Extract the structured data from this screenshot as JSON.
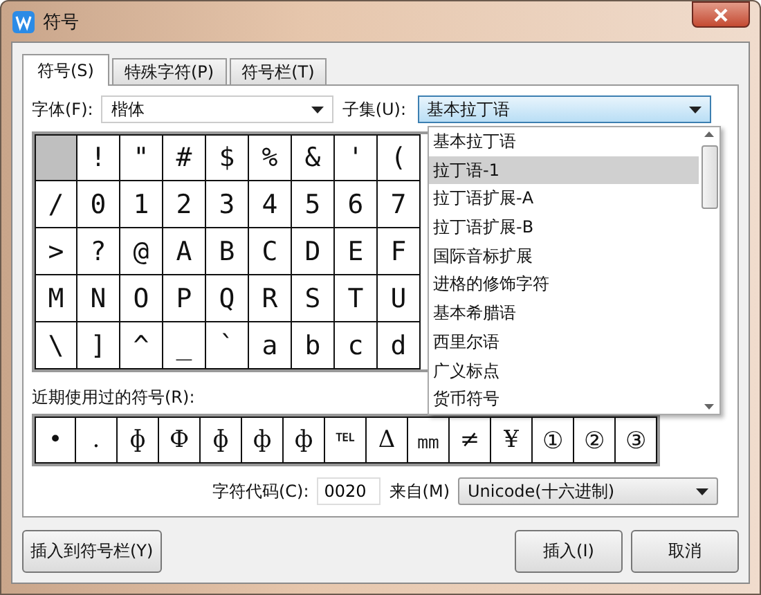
{
  "window": {
    "title": "符号"
  },
  "tabs": [
    {
      "label": "符号(S)",
      "selected": true
    },
    {
      "label": "特殊字符(P)",
      "selected": false
    },
    {
      "label": "符号栏(T)",
      "selected": false
    }
  ],
  "font": {
    "label": "字体(F):",
    "value": "楷体"
  },
  "subset": {
    "label": "子集(U):",
    "value": "基本拉丁语"
  },
  "subset_list": [
    {
      "label": "基本拉丁语",
      "selected": false
    },
    {
      "label": "拉丁语-1",
      "selected": true
    },
    {
      "label": "拉丁语扩展-A",
      "selected": false
    },
    {
      "label": "拉丁语扩展-B",
      "selected": false
    },
    {
      "label": "国际音标扩展",
      "selected": false
    },
    {
      "label": "进格的修饰字符",
      "selected": false
    },
    {
      "label": "基本希腊语",
      "selected": false
    },
    {
      "label": "西里尔语",
      "selected": false
    },
    {
      "label": "广义标点",
      "selected": false
    },
    {
      "label": "货币符号",
      "selected": false
    }
  ],
  "symbol_grid": [
    [
      {
        "selected": true
      },
      {
        "char": "!",
        "selected": false
      },
      {
        "char": "\"",
        "selected": false
      },
      {
        "char": "#",
        "selected": false
      },
      {
        "char": "$",
        "selected": false
      },
      {
        "char": "%",
        "selected": false
      },
      {
        "char": "&",
        "selected": false
      },
      {
        "char": "'",
        "selected": false
      },
      {
        "char": "(",
        "selected": false
      }
    ],
    [
      {
        "char": "/",
        "selected": false
      },
      {
        "char": "0",
        "selected": false
      },
      {
        "char": "1",
        "selected": false
      },
      {
        "char": "2",
        "selected": false
      },
      {
        "char": "3",
        "selected": false
      },
      {
        "char": "4",
        "selected": false
      },
      {
        "char": "5",
        "selected": false
      },
      {
        "char": "6",
        "selected": false
      },
      {
        "char": "7",
        "selected": false
      }
    ],
    [
      {
        "char": ">",
        "selected": false
      },
      {
        "char": "?",
        "selected": false
      },
      {
        "char": "@",
        "selected": false
      },
      {
        "char": "A",
        "selected": false
      },
      {
        "char": "B",
        "selected": false
      },
      {
        "char": "C",
        "selected": false
      },
      {
        "char": "D",
        "selected": false
      },
      {
        "char": "E",
        "selected": false
      },
      {
        "char": "F",
        "selected": false
      }
    ],
    [
      {
        "char": "M",
        "selected": false
      },
      {
        "char": "N",
        "selected": false
      },
      {
        "char": "O",
        "selected": false
      },
      {
        "char": "P",
        "selected": false
      },
      {
        "char": "Q",
        "selected": false
      },
      {
        "char": "R",
        "selected": false
      },
      {
        "char": "S",
        "selected": false
      },
      {
        "char": "T",
        "selected": false
      },
      {
        "char": "U",
        "selected": false
      }
    ],
    [
      {
        "char": "\\",
        "selected": false
      },
      {
        "char": "]",
        "selected": false
      },
      {
        "char": "^",
        "selected": false
      },
      {
        "char": "_",
        "selected": false
      },
      {
        "char": "`",
        "selected": false
      },
      {
        "char": "a",
        "selected": false
      },
      {
        "char": "b",
        "selected": false
      },
      {
        "char": "c",
        "selected": false
      },
      {
        "char": "d",
        "selected": false
      }
    ]
  ],
  "recent": {
    "label": "近期使用过的符号(R):",
    "symbols": [
      "•",
      ".",
      "ɸ",
      "Ф",
      "ɸ",
      "ф",
      "ф",
      "℡",
      "Δ",
      "㎜",
      "≠",
      "¥",
      "①",
      "②",
      "③"
    ]
  },
  "char_code": {
    "label": "字符代码(C):",
    "value": "0020"
  },
  "from": {
    "label": "来自(M)",
    "value": "Unicode(十六进制)"
  },
  "buttons": [
    {
      "label": "插入到符号栏(Y)"
    },
    {
      "label": "插入(I)"
    },
    {
      "label": "取消"
    }
  ]
}
